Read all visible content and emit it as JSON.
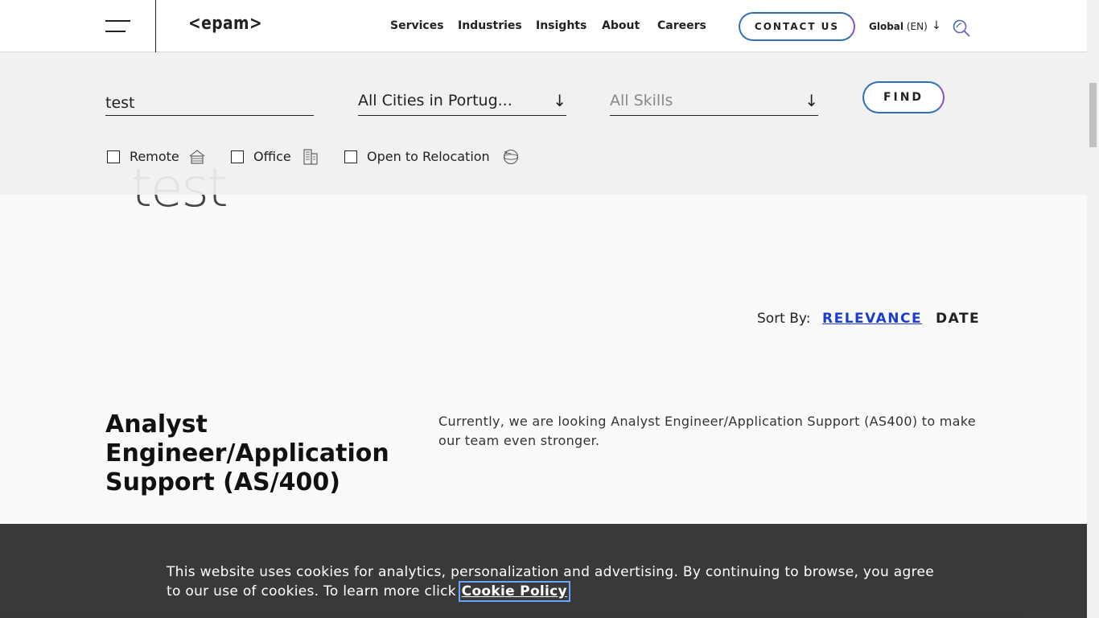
{
  "header": {
    "logo": "<epam>",
    "nav": [
      "Services",
      "Industries",
      "Insights",
      "About",
      "Careers"
    ],
    "contact_label": "CONTACT US",
    "region_label": "Global",
    "lang_label": "(EN)",
    "icons": {
      "menu": "hamburger-icon",
      "region": "arrow-down-icon",
      "search": "search-icon"
    }
  },
  "hero": {
    "heading": "test"
  },
  "search": {
    "keyword_value": "test",
    "city_value": "All Cities in Portug...",
    "skills_value": "All Skills",
    "find_label": "FIND",
    "filters": [
      {
        "label": "Remote",
        "icon": "house-icon",
        "checked": false
      },
      {
        "label": "Office",
        "icon": "office-building-icon",
        "checked": false
      },
      {
        "label": "Open to Relocation",
        "icon": "globe-icon",
        "checked": false
      }
    ]
  },
  "sort": {
    "label": "Sort By:",
    "options": [
      "RELEVANCE",
      "DATE"
    ],
    "active": "RELEVANCE"
  },
  "job": {
    "title": "Analyst Engineer/Application Support (AS/400)",
    "description": "Currently, we are looking Analyst Engineer/Application Support (AS400) to make our team even stronger."
  },
  "cookie": {
    "text": "This website uses cookies for analytics, personalization and advertising. By continuing to browse, you agree to our use of cookies. To learn more click ",
    "link_label": "Cookie Policy"
  },
  "colors": {
    "accent_blue": "#1a3ccf",
    "button_border": "#2e6fb7",
    "button_border_end": "#8a4fc4",
    "cookie_bg": "#282828"
  }
}
